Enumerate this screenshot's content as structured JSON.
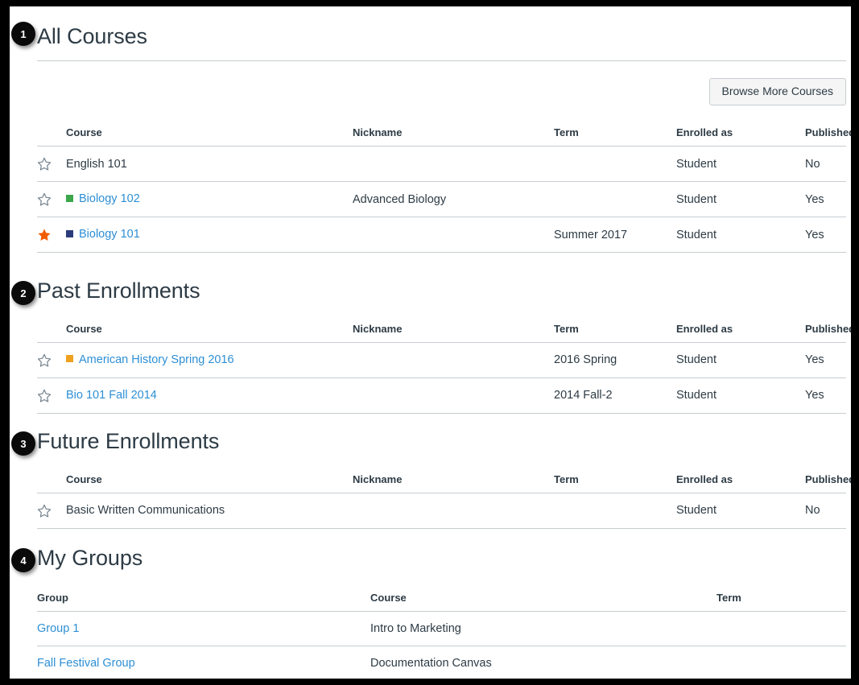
{
  "colors": {
    "link": "#2D8FD5",
    "text": "#2D3B45",
    "border": "#C7CDD1",
    "star_active": "#F15A00",
    "star_inactive": "#73818C",
    "badge_bg": "#0A0A0A",
    "button_bg": "#F5F5F5"
  },
  "sections": {
    "all_courses": {
      "badge": "1",
      "title": "All Courses",
      "browse_button": "Browse More Courses",
      "columns": [
        "Course",
        "Nickname",
        "Term",
        "Enrolled as",
        "Published"
      ],
      "rows": [
        {
          "favorite": false,
          "star_icon": "star-outline-icon",
          "chip_color": null,
          "course": "English 101",
          "course_is_link": false,
          "nickname": "",
          "term": "",
          "enrolled_as": "Student",
          "published": "No"
        },
        {
          "favorite": false,
          "star_icon": "star-outline-icon",
          "chip_color": "#3CA64A",
          "course": "Biology 102",
          "course_is_link": true,
          "nickname": "Advanced Biology",
          "term": "",
          "enrolled_as": "Student",
          "published": "Yes"
        },
        {
          "favorite": true,
          "star_icon": "star-filled-icon",
          "chip_color": "#2B3B7C",
          "course": "Biology 101",
          "course_is_link": true,
          "nickname": "",
          "term": "Summer 2017",
          "enrolled_as": "Student",
          "published": "Yes"
        }
      ]
    },
    "past_enrollments": {
      "badge": "2",
      "title": "Past Enrollments",
      "columns": [
        "Course",
        "Nickname",
        "Term",
        "Enrolled as",
        "Published"
      ],
      "rows": [
        {
          "favorite": false,
          "star_icon": "star-outline-icon",
          "chip_color": "#F0A020",
          "course": "American History Spring 2016",
          "course_is_link": true,
          "nickname": "",
          "term": "2016 Spring",
          "enrolled_as": "Student",
          "published": "Yes"
        },
        {
          "favorite": false,
          "star_icon": "star-outline-icon",
          "chip_color": null,
          "course": "Bio 101 Fall 2014",
          "course_is_link": true,
          "nickname": "",
          "term": "2014 Fall-2",
          "enrolled_as": "Student",
          "published": "Yes"
        }
      ]
    },
    "future_enrollments": {
      "badge": "3",
      "title": "Future Enrollments",
      "columns": [
        "Course",
        "Nickname",
        "Term",
        "Enrolled as",
        "Published"
      ],
      "rows": [
        {
          "favorite": false,
          "star_icon": "star-outline-icon",
          "chip_color": null,
          "course": "Basic Written Communications",
          "course_is_link": false,
          "nickname": "",
          "term": "",
          "enrolled_as": "Student",
          "published": "No"
        }
      ]
    },
    "my_groups": {
      "badge": "4",
      "title": "My Groups",
      "columns": [
        "Group",
        "Course",
        "Term"
      ],
      "rows": [
        {
          "group": "Group 1",
          "group_is_link": true,
          "course": "Intro to Marketing",
          "term": ""
        },
        {
          "group": "Fall Festival Group",
          "group_is_link": true,
          "course": "Documentation Canvas",
          "term": ""
        }
      ]
    }
  }
}
